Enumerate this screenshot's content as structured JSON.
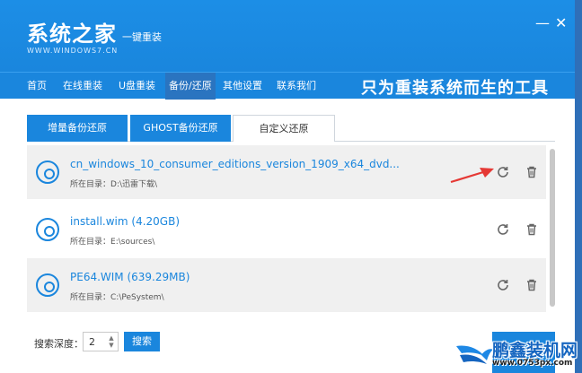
{
  "app": {
    "logo_main": "系统之家",
    "logo_sub": "一键重装",
    "logo_url": "WWW.WINDOWS7.CN",
    "minimize": "—",
    "close": "✕"
  },
  "nav": {
    "items": [
      "首页",
      "在线重装",
      "U盘重装",
      "备份/还原",
      "其他设置",
      "联系我们"
    ],
    "active_index": 3,
    "slogan": "只为重装系统而生的工具"
  },
  "tabs": [
    "增量备份还原",
    "GHOST备份还原",
    "自定义还原"
  ],
  "list": [
    {
      "name": "cn_windows_10_consumer_editions_version_1909_x64_dvd...",
      "path_label": "所在目录：",
      "path": "D:\\迅雷下载\\"
    },
    {
      "name": "install.wim (4.20GB)",
      "path_label": "所在目录：",
      "path": "E:\\sources\\"
    },
    {
      "name": "PE64.WIM (639.29MB)",
      "path_label": "所在目录：",
      "path": "C:\\PeSystem\\"
    }
  ],
  "icons": {
    "restore": "refresh-icon",
    "delete": "trash-icon",
    "disc": "disc-icon"
  },
  "footer": {
    "depth_label": "搜索深度：",
    "depth_value": "2",
    "search_label": "搜索"
  },
  "watermark": {
    "text": "鹏鑫装机网",
    "url": "www.0753px.com"
  },
  "colors": {
    "primary": "#1a86dd",
    "arrow": "#e53935"
  }
}
